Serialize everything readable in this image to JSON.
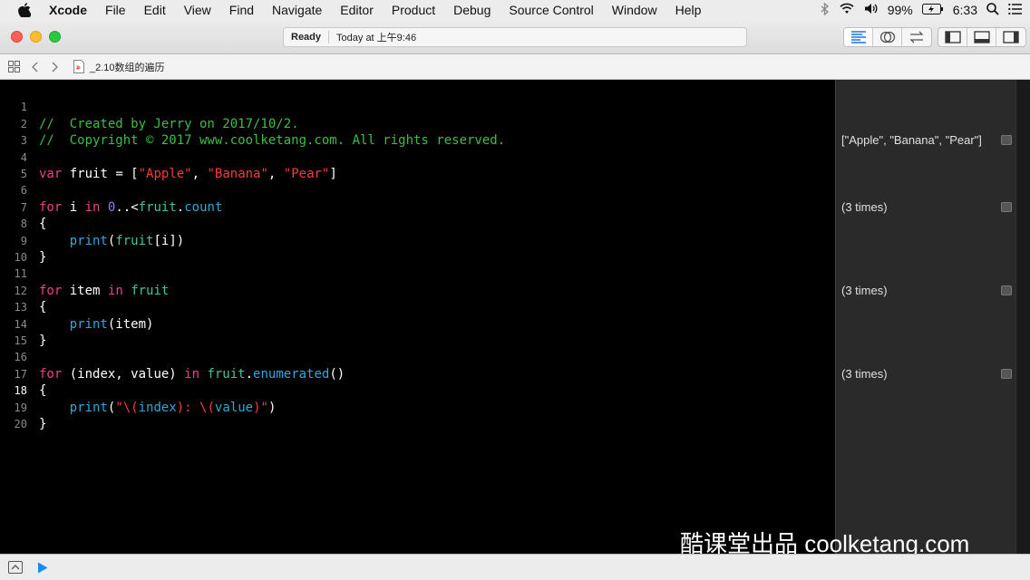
{
  "menubar": {
    "app": "Xcode",
    "items": [
      "File",
      "Edit",
      "View",
      "Find",
      "Navigate",
      "Editor",
      "Product",
      "Debug",
      "Source Control",
      "Window",
      "Help"
    ],
    "battery": "99%",
    "time": "6:33"
  },
  "toolbar": {
    "status_ready": "Ready",
    "status_time": "Today at 上午9:46"
  },
  "jumpbar": {
    "file_name": "_2.10数组的遍历"
  },
  "editor": {
    "current_line": 18,
    "lines": [
      {
        "n": "1"
      },
      {
        "n": "2"
      },
      {
        "n": "3"
      },
      {
        "n": "4"
      },
      {
        "n": "5"
      },
      {
        "n": "6"
      },
      {
        "n": "7"
      },
      {
        "n": "8"
      },
      {
        "n": "9"
      },
      {
        "n": "10"
      },
      {
        "n": "11"
      },
      {
        "n": "12"
      },
      {
        "n": "13"
      },
      {
        "n": "14"
      },
      {
        "n": "15"
      },
      {
        "n": "16"
      },
      {
        "n": "17"
      },
      {
        "n": "18"
      },
      {
        "n": "19"
      },
      {
        "n": "20"
      }
    ],
    "code": {
      "l1": "//  Created by Jerry on 2017/10/2.",
      "l2": "//  Copyright © 2017 www.coolketang.com. All rights reserved.",
      "kw_var": "var",
      "kw_for": "for",
      "kw_in": "in",
      "id_fruit": "fruit",
      "id_i": "i",
      "id_item": "item",
      "id_print": "print",
      "id_count": "count",
      "id_enumerated": "enumerated",
      "str_apple": "\"Apple\"",
      "str_banana": "\"Banana\"",
      "str_pear": "\"Pear\"",
      "num_zero": "0",
      "p_eq_open": " = [",
      "p_comma": ", ",
      "p_close": "]",
      "p_range": "..<",
      "p_dot": ".",
      "p_open_brace": "{",
      "p_close_brace": "}",
      "p_indent": "    ",
      "l8_mid": "(",
      "l8_arg": "fruit",
      "l8_end": "[i])",
      "l13_end": "(item)",
      "l16_tuple": " (index, value) ",
      "l16_end": "()",
      "l18_open": "(",
      "l18_str1": "\"\\(",
      "l18_index": "index",
      "l18_str2": "): \\(",
      "l18_value": "value",
      "l18_str3": ")\"",
      "l18_close": ")"
    }
  },
  "results": [
    {
      "line": 4,
      "text": "[\"Apple\", \"Banana\", \"Pear\"]"
    },
    {
      "line": 8,
      "text": "(3 times)"
    },
    {
      "line": 13,
      "text": "(3 times)"
    },
    {
      "line": 18,
      "text": "(3 times)"
    }
  ],
  "watermark": "酷课堂出品 coolketang.com",
  "colors": {
    "comment": "#3dbd45",
    "keyword": "#e9418d",
    "string": "#fc3a3a",
    "number": "#8f7bff",
    "function": "#2da8dc",
    "variable": "#3ec49a"
  }
}
